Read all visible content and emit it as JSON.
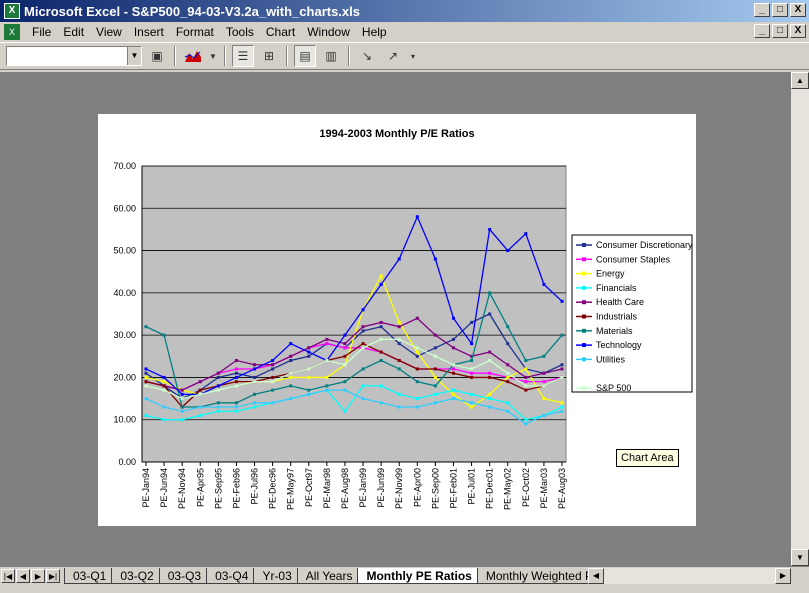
{
  "window": {
    "title": "Microsoft Excel - S&P500_94-03-V3.2a_with_charts.xls",
    "buttons": [
      "_",
      "□",
      "X"
    ],
    "doc_buttons": [
      "_",
      "□",
      "X"
    ]
  },
  "menu": [
    "File",
    "Edit",
    "View",
    "Insert",
    "Format",
    "Tools",
    "Chart",
    "Window",
    "Help"
  ],
  "toolbar": {
    "name_box_value": ""
  },
  "tooltip": "Chart Area",
  "sheet_tabs": [
    "03-Q1",
    "03-Q2",
    "03-Q3",
    "03-Q4",
    "Yr-03",
    "All Years",
    "Monthly PE Ratios",
    "Monthly Weighted PE"
  ],
  "active_tab": "Monthly PE Ratios",
  "chart_data": {
    "type": "line",
    "title": "1994-2003 Monthly P/E Ratios",
    "xlabel": "",
    "ylabel": "",
    "ylim": [
      0,
      70
    ],
    "yticks": [
      "0.00",
      "10.00",
      "20.00",
      "30.00",
      "40.00",
      "50.00",
      "60.00",
      "70.00"
    ],
    "grid": true,
    "legend_position": "right",
    "categories": [
      "PE-Jan94",
      "PE-Jun94",
      "PE-Nov94",
      "PE-Apr95",
      "PE-Sep95",
      "PE-Feb96",
      "PE-Jul96",
      "PE-Dec96",
      "PE-May97",
      "PE-Oct97",
      "PE-Mar98",
      "PE-Aug98",
      "PE-Jan99",
      "PE-Jun99",
      "PE-Nov99",
      "PE-Apr00",
      "PE-Sep00",
      "PE-Feb01",
      "PE-Jul01",
      "PE-Dec01",
      "PE-May02",
      "PE-Oct02",
      "PE-Mar03",
      "PE-Aug03"
    ],
    "series": [
      {
        "name": "Consumer Discretionary",
        "color": "#1f2f8f",
        "values": [
          21,
          18,
          15,
          17,
          20,
          21,
          20,
          22,
          24,
          25,
          28,
          27,
          31,
          32,
          28,
          25,
          27,
          29,
          33,
          35,
          28,
          22,
          21,
          23
        ]
      },
      {
        "name": "Consumer Staples",
        "color": "#ff00ff",
        "values": [
          19,
          18,
          17,
          19,
          21,
          22,
          22,
          23,
          25,
          27,
          28,
          27,
          27,
          26,
          24,
          22,
          22,
          22,
          21,
          21,
          20,
          19,
          19,
          20
        ]
      },
      {
        "name": "Energy",
        "color": "#ffff00",
        "values": [
          20,
          19,
          17,
          16,
          18,
          19,
          19,
          19,
          20,
          20,
          20,
          23,
          36,
          44,
          33,
          26,
          20,
          16,
          13,
          16,
          20,
          22,
          15,
          14
        ]
      },
      {
        "name": "Financials",
        "color": "#00ffff",
        "values": [
          11,
          10,
          10,
          11,
          12,
          12,
          13,
          14,
          15,
          16,
          17,
          12,
          18,
          18,
          16,
          15,
          16,
          17,
          16,
          15,
          14,
          10,
          11,
          13
        ]
      },
      {
        "name": "Health Care",
        "color": "#800080",
        "values": [
          19,
          18,
          17,
          19,
          21,
          24,
          23,
          23,
          25,
          27,
          29,
          28,
          32,
          33,
          32,
          34,
          30,
          27,
          25,
          26,
          23,
          20,
          21,
          22
        ]
      },
      {
        "name": "Industrials",
        "color": "#800000",
        "values": [
          19,
          18,
          13,
          17,
          18,
          19,
          19,
          20,
          21,
          22,
          24,
          25,
          28,
          26,
          24,
          22,
          22,
          21,
          20,
          20,
          19,
          17,
          18,
          20
        ]
      },
      {
        "name": "Materials",
        "color": "#008080",
        "values": [
          32,
          30,
          13,
          13,
          14,
          14,
          16,
          17,
          18,
          17,
          18,
          19,
          22,
          24,
          22,
          19,
          18,
          23,
          24,
          40,
          32,
          24,
          25,
          30
        ]
      },
      {
        "name": "Technology",
        "color": "#0000ff",
        "values": [
          22,
          20,
          16,
          16,
          18,
          20,
          22,
          24,
          28,
          26,
          24,
          30,
          36,
          42,
          48,
          58,
          48,
          34,
          28,
          55,
          50,
          54,
          42,
          38
        ]
      },
      {
        "name": "Utilities",
        "color": "#33ccff",
        "values": [
          15,
          13,
          12,
          13,
          13,
          13,
          14,
          14,
          15,
          16,
          17,
          17,
          15,
          14,
          13,
          13,
          14,
          15,
          14,
          13,
          12,
          9,
          11,
          12
        ]
      },
      {
        "name": "",
        "color": "#ffffff",
        "values": []
      },
      {
        "name": "S&P 500",
        "color": "#ccffcc",
        "values": [
          18,
          17,
          15,
          16,
          17,
          18,
          19,
          19,
          21,
          22,
          24,
          23,
          27,
          29,
          29,
          27,
          25,
          23,
          22,
          24,
          21,
          18,
          18,
          20
        ]
      }
    ]
  }
}
